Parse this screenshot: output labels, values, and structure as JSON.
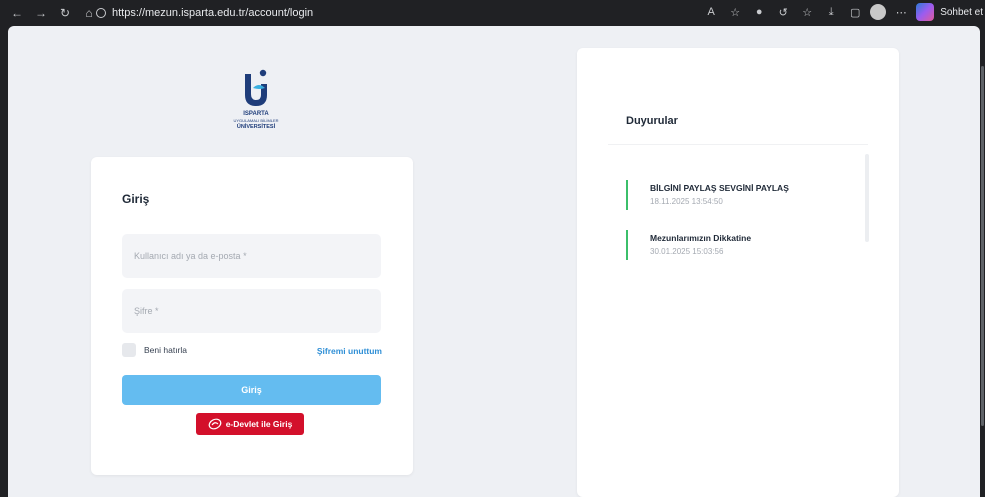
{
  "browser": {
    "url": "https://mezun.isparta.edu.tr/account/login",
    "sidebar_label": "Sohbet et"
  },
  "logo": {
    "line1": "ISPARTA",
    "line2": "UYGULAMALI BİLİMLER",
    "line3": "ÜNİVERSİTESİ",
    "colors": {
      "primary": "#1f3d7a",
      "accent": "#3ab0e0"
    }
  },
  "login": {
    "title": "Giriş",
    "username_placeholder": "Kullanıcı adı ya da e-posta *",
    "password_placeholder": "Şifre *",
    "remember_label": "Beni hatırla",
    "forgot_label": "Şifremi unuttum",
    "submit_label": "Giriş",
    "edevlet_label": "e-Devlet ile Giriş",
    "colors": {
      "submit": "#64bcf0",
      "edevlet": "#d3102b",
      "link": "#2f8fd6"
    }
  },
  "announcements": {
    "title": "Duyurular",
    "items": [
      {
        "title": "BİLGİNİ PAYLAŞ SEVGİNİ PAYLAŞ",
        "date": "18.11.2025 13:54:50"
      },
      {
        "title": "Mezunlarımızın Dikkatine",
        "date": "30.01.2025 15:03:56"
      }
    ],
    "accent_color": "#3bbf6a"
  }
}
